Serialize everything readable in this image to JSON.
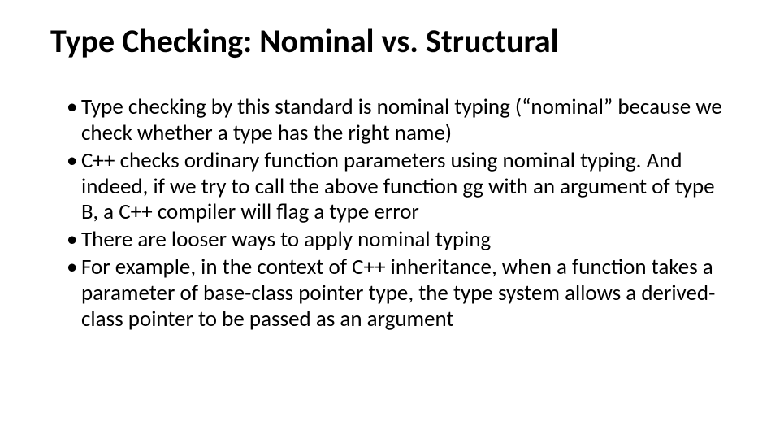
{
  "slide": {
    "title": "Type Checking: Nominal vs. Structural",
    "bullets": [
      "Type checking by this standard is nominal typing (“nominal” because we check whether a type has the right name)",
      "C++ checks ordinary function parameters using nominal typing. And indeed, if we try to call the above function gg with an argument of type B, a C++ compiler will flag a type error",
      "There are looser ways to apply nominal typing",
      "For example, in the context of C++ inheritance, when a function takes a parameter of base-class pointer type, the type system allows a derived-class pointer to be passed as an argument"
    ]
  }
}
